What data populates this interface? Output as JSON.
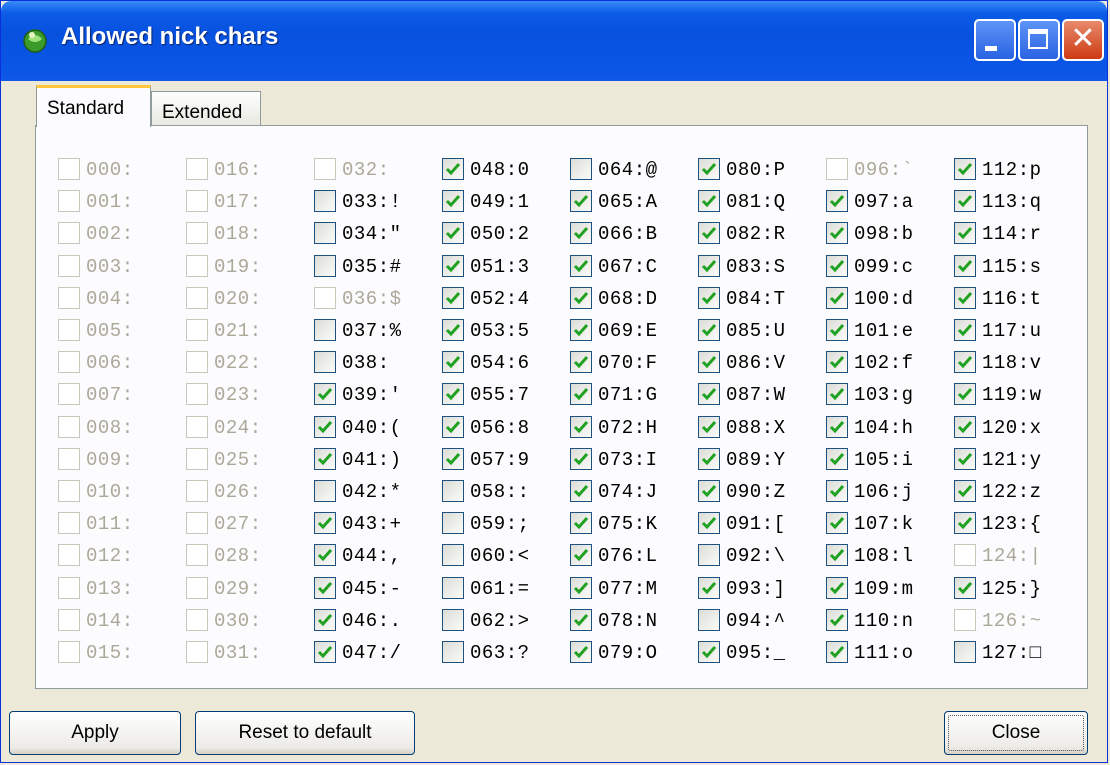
{
  "window": {
    "title": "Allowed nick chars",
    "icon": "app-green-icon",
    "controls": [
      "minimize-icon",
      "maximize-icon",
      "close-icon"
    ],
    "close_glyph": "✕"
  },
  "tabs": [
    {
      "label": "Standard",
      "active": true
    },
    {
      "label": "Extended",
      "active": false
    }
  ],
  "colors": {
    "titlebar": "#0a56e6",
    "checkmark": "#21a121",
    "disabled_text": "#aca899"
  },
  "chars": [
    {
      "label": "000:",
      "checked": false,
      "enabled": false
    },
    {
      "label": "001:",
      "checked": false,
      "enabled": false
    },
    {
      "label": "002:",
      "checked": false,
      "enabled": false
    },
    {
      "label": "003:",
      "checked": false,
      "enabled": false
    },
    {
      "label": "004:",
      "checked": false,
      "enabled": false
    },
    {
      "label": "005:",
      "checked": false,
      "enabled": false
    },
    {
      "label": "006:",
      "checked": false,
      "enabled": false
    },
    {
      "label": "007:",
      "checked": false,
      "enabled": false
    },
    {
      "label": "008:",
      "checked": false,
      "enabled": false
    },
    {
      "label": "009:",
      "checked": false,
      "enabled": false
    },
    {
      "label": "010:",
      "checked": false,
      "enabled": false
    },
    {
      "label": "011:",
      "checked": false,
      "enabled": false
    },
    {
      "label": "012:",
      "checked": false,
      "enabled": false
    },
    {
      "label": "013:",
      "checked": false,
      "enabled": false
    },
    {
      "label": "014:",
      "checked": false,
      "enabled": false
    },
    {
      "label": "015:",
      "checked": false,
      "enabled": false
    },
    {
      "label": "016:",
      "checked": false,
      "enabled": false
    },
    {
      "label": "017:",
      "checked": false,
      "enabled": false
    },
    {
      "label": "018:",
      "checked": false,
      "enabled": false
    },
    {
      "label": "019:",
      "checked": false,
      "enabled": false
    },
    {
      "label": "020:",
      "checked": false,
      "enabled": false
    },
    {
      "label": "021:",
      "checked": false,
      "enabled": false
    },
    {
      "label": "022:",
      "checked": false,
      "enabled": false
    },
    {
      "label": "023:",
      "checked": false,
      "enabled": false
    },
    {
      "label": "024:",
      "checked": false,
      "enabled": false
    },
    {
      "label": "025:",
      "checked": false,
      "enabled": false
    },
    {
      "label": "026:",
      "checked": false,
      "enabled": false
    },
    {
      "label": "027:",
      "checked": false,
      "enabled": false
    },
    {
      "label": "028:",
      "checked": false,
      "enabled": false
    },
    {
      "label": "029:",
      "checked": false,
      "enabled": false
    },
    {
      "label": "030:",
      "checked": false,
      "enabled": false
    },
    {
      "label": "031:",
      "checked": false,
      "enabled": false
    },
    {
      "label": "032: ",
      "checked": false,
      "enabled": false
    },
    {
      "label": "033:!",
      "checked": false,
      "enabled": true
    },
    {
      "label": "034:\"",
      "checked": false,
      "enabled": true
    },
    {
      "label": "035:#",
      "checked": false,
      "enabled": true
    },
    {
      "label": "036:$",
      "checked": false,
      "enabled": false
    },
    {
      "label": "037:%",
      "checked": false,
      "enabled": true
    },
    {
      "label": "038:",
      "checked": false,
      "enabled": true
    },
    {
      "label": "039:'",
      "checked": true,
      "enabled": true
    },
    {
      "label": "040:(",
      "checked": true,
      "enabled": true
    },
    {
      "label": "041:)",
      "checked": true,
      "enabled": true
    },
    {
      "label": "042:*",
      "checked": false,
      "enabled": true
    },
    {
      "label": "043:+",
      "checked": true,
      "enabled": true
    },
    {
      "label": "044:,",
      "checked": true,
      "enabled": true
    },
    {
      "label": "045:-",
      "checked": true,
      "enabled": true
    },
    {
      "label": "046:.",
      "checked": true,
      "enabled": true
    },
    {
      "label": "047:/",
      "checked": true,
      "enabled": true
    },
    {
      "label": "048:0",
      "checked": true,
      "enabled": true
    },
    {
      "label": "049:1",
      "checked": true,
      "enabled": true
    },
    {
      "label": "050:2",
      "checked": true,
      "enabled": true
    },
    {
      "label": "051:3",
      "checked": true,
      "enabled": true
    },
    {
      "label": "052:4",
      "checked": true,
      "enabled": true
    },
    {
      "label": "053:5",
      "checked": true,
      "enabled": true
    },
    {
      "label": "054:6",
      "checked": true,
      "enabled": true
    },
    {
      "label": "055:7",
      "checked": true,
      "enabled": true
    },
    {
      "label": "056:8",
      "checked": true,
      "enabled": true
    },
    {
      "label": "057:9",
      "checked": true,
      "enabled": true
    },
    {
      "label": "058::",
      "checked": false,
      "enabled": true
    },
    {
      "label": "059:;",
      "checked": false,
      "enabled": true
    },
    {
      "label": "060:<",
      "checked": false,
      "enabled": true
    },
    {
      "label": "061:=",
      "checked": false,
      "enabled": true
    },
    {
      "label": "062:>",
      "checked": false,
      "enabled": true
    },
    {
      "label": "063:?",
      "checked": false,
      "enabled": true
    },
    {
      "label": "064:@",
      "checked": false,
      "enabled": true
    },
    {
      "label": "065:A",
      "checked": true,
      "enabled": true
    },
    {
      "label": "066:B",
      "checked": true,
      "enabled": true
    },
    {
      "label": "067:C",
      "checked": true,
      "enabled": true
    },
    {
      "label": "068:D",
      "checked": true,
      "enabled": true
    },
    {
      "label": "069:E",
      "checked": true,
      "enabled": true
    },
    {
      "label": "070:F",
      "checked": true,
      "enabled": true
    },
    {
      "label": "071:G",
      "checked": true,
      "enabled": true
    },
    {
      "label": "072:H",
      "checked": true,
      "enabled": true
    },
    {
      "label": "073:I",
      "checked": true,
      "enabled": true
    },
    {
      "label": "074:J",
      "checked": true,
      "enabled": true
    },
    {
      "label": "075:K",
      "checked": true,
      "enabled": true
    },
    {
      "label": "076:L",
      "checked": true,
      "enabled": true
    },
    {
      "label": "077:M",
      "checked": true,
      "enabled": true
    },
    {
      "label": "078:N",
      "checked": true,
      "enabled": true
    },
    {
      "label": "079:O",
      "checked": true,
      "enabled": true
    },
    {
      "label": "080:P",
      "checked": true,
      "enabled": true
    },
    {
      "label": "081:Q",
      "checked": true,
      "enabled": true
    },
    {
      "label": "082:R",
      "checked": true,
      "enabled": true
    },
    {
      "label": "083:S",
      "checked": true,
      "enabled": true
    },
    {
      "label": "084:T",
      "checked": true,
      "enabled": true
    },
    {
      "label": "085:U",
      "checked": true,
      "enabled": true
    },
    {
      "label": "086:V",
      "checked": true,
      "enabled": true
    },
    {
      "label": "087:W",
      "checked": true,
      "enabled": true
    },
    {
      "label": "088:X",
      "checked": true,
      "enabled": true
    },
    {
      "label": "089:Y",
      "checked": true,
      "enabled": true
    },
    {
      "label": "090:Z",
      "checked": true,
      "enabled": true
    },
    {
      "label": "091:[",
      "checked": true,
      "enabled": true
    },
    {
      "label": "092:\\",
      "checked": false,
      "enabled": true
    },
    {
      "label": "093:]",
      "checked": true,
      "enabled": true
    },
    {
      "label": "094:^",
      "checked": false,
      "enabled": true
    },
    {
      "label": "095:_",
      "checked": true,
      "enabled": true
    },
    {
      "label": "096:`",
      "checked": false,
      "enabled": false
    },
    {
      "label": "097:a",
      "checked": true,
      "enabled": true
    },
    {
      "label": "098:b",
      "checked": true,
      "enabled": true
    },
    {
      "label": "099:c",
      "checked": true,
      "enabled": true
    },
    {
      "label": "100:d",
      "checked": true,
      "enabled": true
    },
    {
      "label": "101:e",
      "checked": true,
      "enabled": true
    },
    {
      "label": "102:f",
      "checked": true,
      "enabled": true
    },
    {
      "label": "103:g",
      "checked": true,
      "enabled": true
    },
    {
      "label": "104:h",
      "checked": true,
      "enabled": true
    },
    {
      "label": "105:i",
      "checked": true,
      "enabled": true
    },
    {
      "label": "106:j",
      "checked": true,
      "enabled": true
    },
    {
      "label": "107:k",
      "checked": true,
      "enabled": true
    },
    {
      "label": "108:l",
      "checked": true,
      "enabled": true
    },
    {
      "label": "109:m",
      "checked": true,
      "enabled": true
    },
    {
      "label": "110:n",
      "checked": true,
      "enabled": true
    },
    {
      "label": "111:o",
      "checked": true,
      "enabled": true
    },
    {
      "label": "112:p",
      "checked": true,
      "enabled": true
    },
    {
      "label": "113:q",
      "checked": true,
      "enabled": true
    },
    {
      "label": "114:r",
      "checked": true,
      "enabled": true
    },
    {
      "label": "115:s",
      "checked": true,
      "enabled": true
    },
    {
      "label": "116:t",
      "checked": true,
      "enabled": true
    },
    {
      "label": "117:u",
      "checked": true,
      "enabled": true
    },
    {
      "label": "118:v",
      "checked": true,
      "enabled": true
    },
    {
      "label": "119:w",
      "checked": true,
      "enabled": true
    },
    {
      "label": "120:x",
      "checked": true,
      "enabled": true
    },
    {
      "label": "121:y",
      "checked": true,
      "enabled": true
    },
    {
      "label": "122:z",
      "checked": true,
      "enabled": true
    },
    {
      "label": "123:{",
      "checked": true,
      "enabled": true
    },
    {
      "label": "124:|",
      "checked": false,
      "enabled": false
    },
    {
      "label": "125:}",
      "checked": true,
      "enabled": true
    },
    {
      "label": "126:~",
      "checked": false,
      "enabled": false
    },
    {
      "label": "127:□",
      "checked": false,
      "enabled": true
    }
  ],
  "buttons": {
    "apply": "Apply",
    "reset": "Reset to default",
    "close": "Close"
  }
}
